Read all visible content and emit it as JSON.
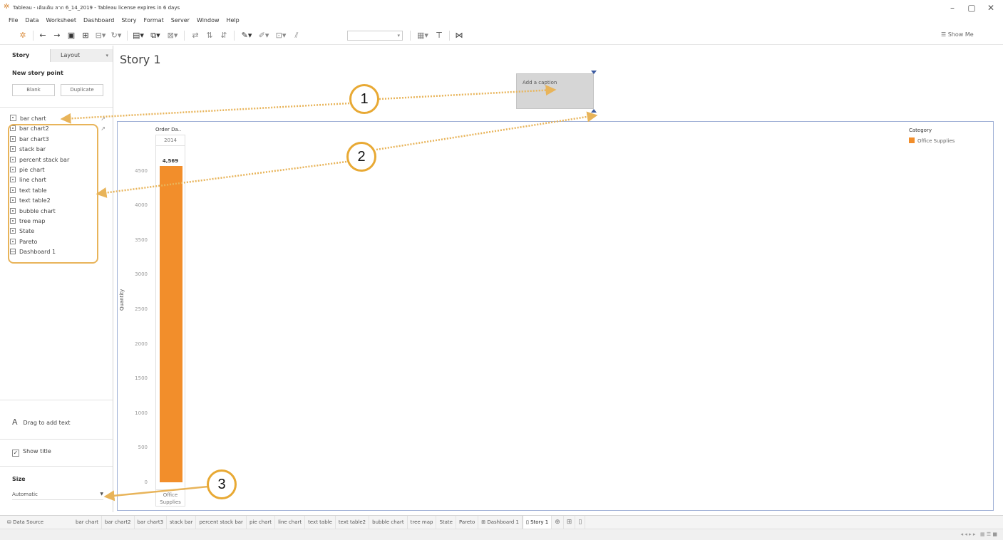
{
  "window": {
    "title": "Tableau - เดิมเดิม ลาก 6_14_2019 - Tableau license expires in 6 days",
    "min": "–",
    "max": "▢",
    "close": "✕"
  },
  "menu": [
    "File",
    "Data",
    "Worksheet",
    "Dashboard",
    "Story",
    "Format",
    "Server",
    "Window",
    "Help"
  ],
  "toolbar": {
    "show_me": "Show Me"
  },
  "side": {
    "tab_story": "Story",
    "tab_layout": "Layout",
    "new_story_point": "New story point",
    "blank": "Blank",
    "duplicate": "Duplicate",
    "items": [
      {
        "label": "bar chart"
      },
      {
        "label": "bar chart2"
      },
      {
        "label": "bar chart3"
      },
      {
        "label": "stack bar"
      },
      {
        "label": "percent stack bar"
      },
      {
        "label": "pie chart"
      },
      {
        "label": "line chart"
      },
      {
        "label": "text table"
      },
      {
        "label": "text table2"
      },
      {
        "label": "bubble chart"
      },
      {
        "label": "tree map"
      },
      {
        "label": "State"
      },
      {
        "label": "Pareto"
      },
      {
        "label": "Dashboard 1"
      }
    ],
    "drag_text": "Drag to add text",
    "show_title": "Show title",
    "size_label": "Size",
    "size_value": "Automatic"
  },
  "story": {
    "title": "Story 1",
    "caption": "Add a caption"
  },
  "chart_data": {
    "type": "bar",
    "column_header": "Order Da..",
    "year": "2014",
    "categories": [
      "Office Supplies"
    ],
    "values": [
      4569
    ],
    "value_label": "4,569",
    "ylabel": "Quantity",
    "ylim": [
      0,
      4569
    ],
    "yticks": [
      "4500",
      "4000",
      "3500",
      "3000",
      "2500",
      "2000",
      "1500",
      "1000",
      "500",
      "0"
    ],
    "legend_title": "Category",
    "legend": [
      {
        "name": "Office Supplies",
        "color": "#f28e2b"
      }
    ],
    "color": "#f28e2b"
  },
  "callouts": [
    "1",
    "2",
    "3"
  ],
  "tabs": {
    "data_source": "Data Source",
    "sheets": [
      "bar chart",
      "bar chart2",
      "bar chart3",
      "stack bar",
      "percent stack bar",
      "pie chart",
      "line chart",
      "text table",
      "text table2",
      "bubble chart",
      "tree map",
      "State",
      "Pareto",
      "Dashboard 1",
      "Story 1"
    ],
    "current": "Story 1"
  }
}
